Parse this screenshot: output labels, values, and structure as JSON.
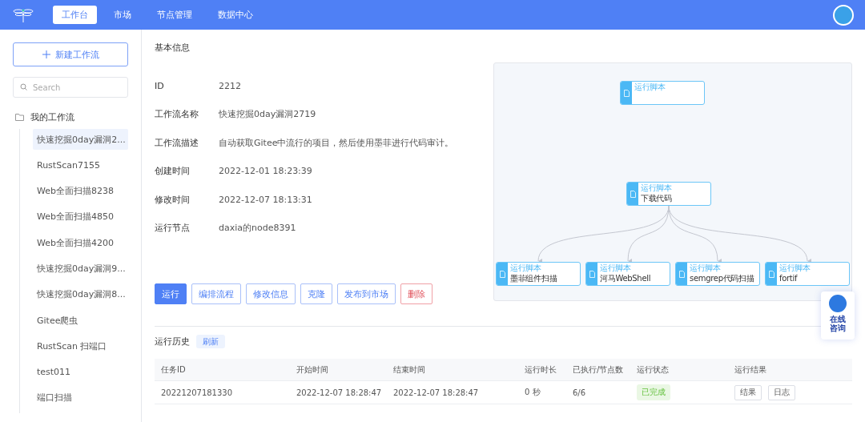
{
  "nav": {
    "tabs": [
      {
        "label": "工作台",
        "selected": true
      },
      {
        "label": "市场",
        "selected": false
      },
      {
        "label": "节点管理",
        "selected": false
      },
      {
        "label": "数据中心",
        "selected": false
      }
    ]
  },
  "sidebar": {
    "new_button": "新建工作流",
    "search": {
      "placeholder": "Search"
    },
    "folder": "我的工作流",
    "items": [
      {
        "label": "快速挖掘0day漏洞2...",
        "selected": true
      },
      {
        "label": "RustScan7155",
        "selected": false
      },
      {
        "label": "Web全面扫描8238",
        "selected": false
      },
      {
        "label": "Web全面扫描4850",
        "selected": false
      },
      {
        "label": "Web全面扫描4200",
        "selected": false
      },
      {
        "label": "快速挖掘0day漏洞9...",
        "selected": false
      },
      {
        "label": "快速挖掘0day漏洞8...",
        "selected": false
      },
      {
        "label": "Gitee爬虫",
        "selected": false
      },
      {
        "label": "RustScan 扫端口",
        "selected": false
      },
      {
        "label": "test011",
        "selected": false
      },
      {
        "label": "端口扫描",
        "selected": false
      }
    ]
  },
  "section_title": "基本信息",
  "fields": [
    {
      "label": "ID",
      "value": "2212"
    },
    {
      "label": "工作流名称",
      "value": "快速挖掘0day漏洞2719"
    },
    {
      "label": "工作流描述",
      "value": "自动获取Gitee中流行的项目，然后使用墨菲进行代码审计。"
    },
    {
      "label": "创建时间",
      "value": "2022-12-01 18:23:39"
    },
    {
      "label": "修改时间",
      "value": "2022-12-07 18:13:31"
    },
    {
      "label": "运行节点",
      "value": "daxia的node8391"
    }
  ],
  "actions": [
    {
      "label": "运行",
      "kind": "primary"
    },
    {
      "label": "编排流程",
      "kind": "outline"
    },
    {
      "label": "修改信息",
      "kind": "outline"
    },
    {
      "label": "克隆",
      "kind": "outline"
    },
    {
      "label": "发布到市场",
      "kind": "outline"
    },
    {
      "label": "删除",
      "kind": "danger"
    }
  ],
  "diagram": {
    "nodes": [
      {
        "title": "运行脚本",
        "kind": "start"
      },
      {
        "title": "运行脚本",
        "subtitle": "下载代码",
        "kind": "hub"
      },
      {
        "title": "运行脚本",
        "subtitle": "墨菲组件扫描",
        "kind": "leaf"
      },
      {
        "title": "运行脚本",
        "subtitle": "河马WebShell",
        "kind": "leaf"
      },
      {
        "title": "运行脚本",
        "subtitle": "semgrep代码扫描",
        "kind": "leaf"
      },
      {
        "title": "运行脚本",
        "subtitle": "fortif",
        "kind": "leaf"
      }
    ]
  },
  "history": {
    "title": "运行历史",
    "refresh": "刷新",
    "columns": [
      "任务ID",
      "开始时间",
      "结束时间",
      "运行时长",
      "已执行/节点数",
      "运行状态",
      "运行结果"
    ],
    "rows": [
      {
        "id": "20221207181330",
        "start": "2022-12-07 18:28:47",
        "end": "2022-12-07 18:28:47",
        "duration": "0 秒",
        "progress": "6/6",
        "status": "已完成",
        "buttons": [
          "结果",
          "日志"
        ]
      }
    ]
  },
  "chat_widget": {
    "label": "在线咨询"
  }
}
